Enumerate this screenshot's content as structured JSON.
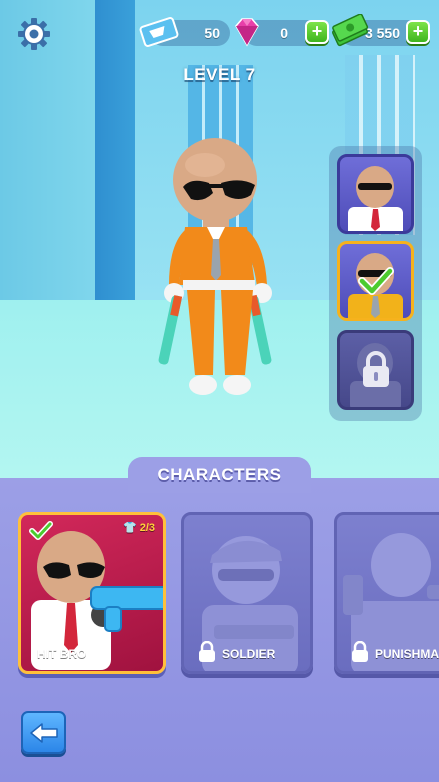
{
  "hud": {
    "settings_icon": "gear-icon",
    "tickets": "50",
    "gems": "0",
    "cash": "3 550"
  },
  "level": {
    "title": "LEVEL 7"
  },
  "skins": [
    {
      "id": "skin-1",
      "state": "available"
    },
    {
      "id": "skin-2",
      "state": "selected"
    },
    {
      "id": "skin-3",
      "state": "locked"
    }
  ],
  "characters_panel": {
    "title": "CHARACTERS",
    "cards": [
      {
        "name": "HIT BRO",
        "count": "2/3",
        "state": "selected"
      },
      {
        "name": "SOLDIER",
        "state": "locked"
      },
      {
        "name": "PUNISHMA",
        "state": "locked"
      }
    ]
  },
  "colors": {
    "accent_green": "#3fb51e",
    "gold": "#ffc03a",
    "card_red": "#c21e4e",
    "panel_purple": "#9c9fe6"
  }
}
